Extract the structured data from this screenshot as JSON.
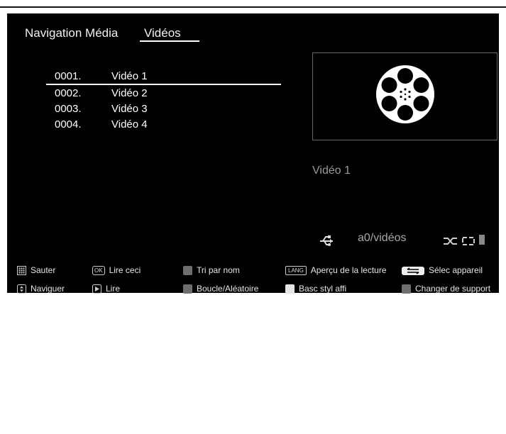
{
  "header": {
    "title": "Navigation Média",
    "tab": "Vidéos"
  },
  "list": [
    {
      "num": "0001.",
      "name": "Vidéo 1"
    },
    {
      "num": "0002.",
      "name": "Vidéo 2"
    },
    {
      "num": "0003.",
      "name": "Vidéo 3"
    },
    {
      "num": "0004.",
      "name": "Vidéo 4"
    }
  ],
  "preview": {
    "title": "Vidéo 1",
    "icon": "film-reel-icon"
  },
  "status": {
    "path": "a0/vidéos",
    "icons": [
      "usb-icon",
      "shuffle-icon",
      "loop-icon"
    ]
  },
  "hints": {
    "row1": [
      {
        "icon": "grid-key-icon",
        "label": "Sauter"
      },
      {
        "icon": "ok-key-icon",
        "key": "OK",
        "label": "Lire ceci"
      },
      {
        "icon": "gray-key-icon",
        "label": "Tri par nom"
      },
      {
        "icon": "lang-key-icon",
        "key": "LANG",
        "label": "Aperçu de la lecture"
      },
      {
        "icon": "source-key-icon",
        "label": "Sélec appareil"
      }
    ],
    "row2": [
      {
        "icon": "updown-key-icon",
        "label": "Naviguer"
      },
      {
        "icon": "play-key-icon",
        "label": "Lire"
      },
      {
        "icon": "gray-key-icon",
        "label": "Boucle/Aléatoire"
      },
      {
        "icon": "white-key-icon",
        "label": "Basc styl affi"
      },
      {
        "icon": "gray-key-icon",
        "label": "Changer de support"
      }
    ]
  },
  "colors": {
    "background": "#000000",
    "text": "#ffffff",
    "muted": "#9a9a9a",
    "key_gray": "#6e6e6e"
  }
}
